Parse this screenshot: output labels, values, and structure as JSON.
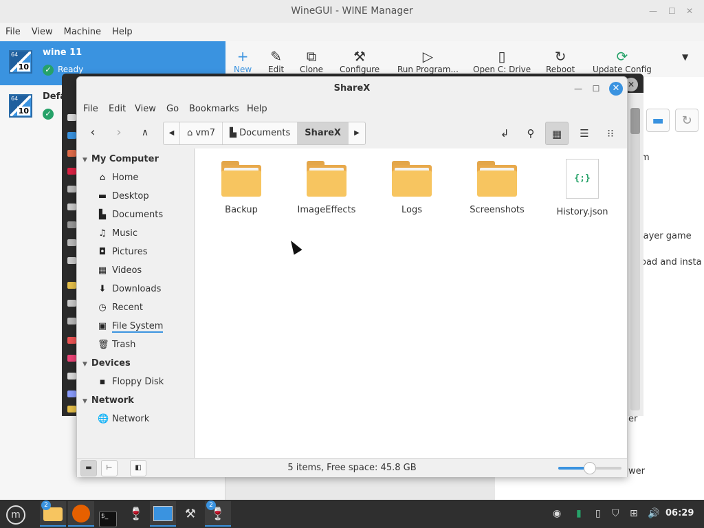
{
  "winegui": {
    "title": "WineGUI - WINE Manager",
    "menu": [
      "File",
      "View",
      "Machine",
      "Help"
    ],
    "bottles": [
      {
        "name": "wine 11",
        "status": "Ready",
        "badge": "10",
        "small": "64"
      },
      {
        "name": "Defa",
        "status": "",
        "badge": "10",
        "small": "64"
      }
    ],
    "toolbar": [
      {
        "label": "New",
        "icon": "+"
      },
      {
        "label": "Edit",
        "icon": "✎"
      },
      {
        "label": "Clone",
        "icon": "⧉"
      },
      {
        "label": "Configure",
        "icon": "⚒"
      },
      {
        "label": "Run Program...",
        "icon": "▷"
      },
      {
        "label": "Open C: Drive",
        "icon": "▯"
      },
      {
        "label": "Reboot",
        "icon": "↻"
      },
      {
        "label": "Update Config",
        "icon": "⟳"
      }
    ],
    "right_fragments": [
      "m",
      "layer game",
      "oad and insta",
      "er",
      "wer"
    ]
  },
  "file_manager": {
    "title": "ShareX",
    "menu": [
      "File",
      "Edit",
      "View",
      "Go",
      "Bookmarks",
      "Help"
    ],
    "path": [
      "vm7",
      "Documents",
      "ShareX"
    ],
    "sidebar": {
      "sections": [
        {
          "title": "My Computer",
          "items": [
            {
              "label": "Home",
              "icon": "⌂"
            },
            {
              "label": "Desktop",
              "icon": "▬"
            },
            {
              "label": "Documents",
              "icon": "▙"
            },
            {
              "label": "Music",
              "icon": "♫"
            },
            {
              "label": "Pictures",
              "icon": "◘"
            },
            {
              "label": "Videos",
              "icon": "▦"
            },
            {
              "label": "Downloads",
              "icon": "⬇"
            },
            {
              "label": "Recent",
              "icon": "◷"
            },
            {
              "label": "File System",
              "icon": "▣"
            },
            {
              "label": "Trash",
              "icon": "🗑"
            }
          ]
        },
        {
          "title": "Devices",
          "items": [
            {
              "label": "Floppy Disk",
              "icon": "▪"
            }
          ]
        },
        {
          "title": "Network",
          "items": [
            {
              "label": "Network",
              "icon": "🌐"
            }
          ]
        }
      ]
    },
    "items": [
      {
        "name": "Backup",
        "type": "folder"
      },
      {
        "name": "ImageEffects",
        "type": "folder"
      },
      {
        "name": "Logs",
        "type": "folder"
      },
      {
        "name": "Screenshots",
        "type": "folder"
      },
      {
        "name": "History.json",
        "type": "json",
        "glyph": "{;}"
      }
    ],
    "status": "5 items, Free space: 45.8 GB",
    "zoom_level": 0.5
  },
  "taskbar": {
    "clock": "06:29",
    "badges": [
      "2",
      "2"
    ]
  },
  "colors": {
    "accent": "#3a93e0",
    "folder": "#f7c560",
    "ready_green": "#26a269"
  }
}
